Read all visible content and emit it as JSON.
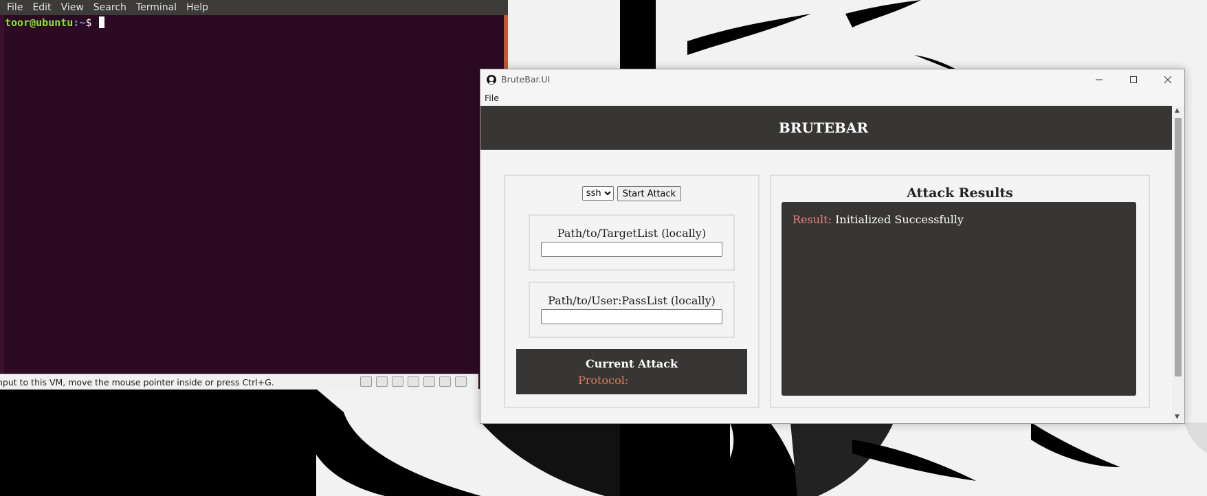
{
  "terminal": {
    "menu": [
      "File",
      "Edit",
      "View",
      "Search",
      "Terminal",
      "Help"
    ],
    "prompt_user_host": "toor@ubuntu",
    "prompt_path": ":~",
    "prompt_symbol": "$ "
  },
  "vm_status": {
    "message": "nput to this VM, move the mouse pointer inside or press Ctrl+G."
  },
  "app": {
    "window_title": "BruteBar.UI",
    "menu_file": "File",
    "header_title": "BRUTEBAR",
    "protocol_selected": "ssh",
    "start_button": "Start Attack",
    "target_label": "Path/to/TargetList (locally)",
    "passlist_label": "Path/to/User:PassList (locally)",
    "current_attack_title": "Current Attack",
    "protocol_label": "Protocol:",
    "results_title": "Attack Results",
    "result_key": "Result:",
    "result_value": "Initialized Successfully"
  },
  "colors": {
    "terminal_bg": "#2c0a23",
    "header_bg": "#373634",
    "accent_salmon": "#e07a5f"
  }
}
